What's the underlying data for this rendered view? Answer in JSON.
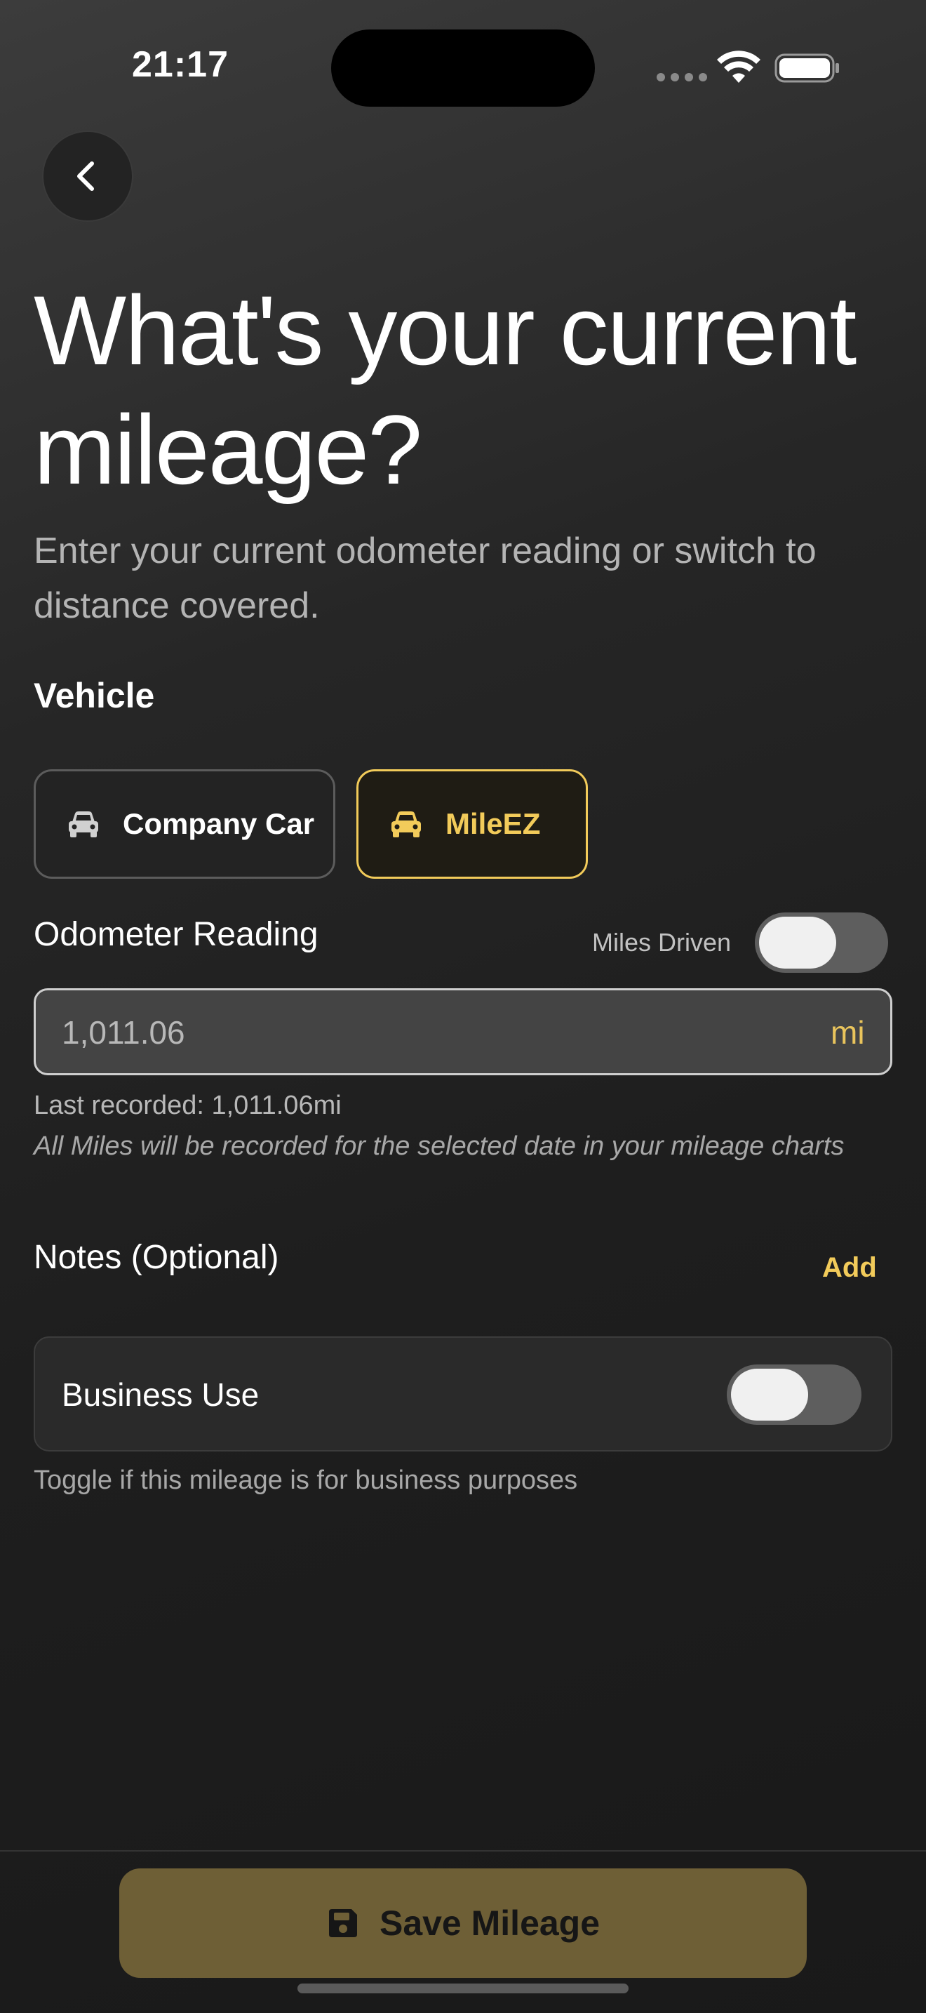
{
  "status_bar": {
    "time": "21:17",
    "icons": [
      "signal-dots-icon",
      "wifi-icon",
      "battery-icon"
    ]
  },
  "nav": {
    "back_icon": "chevron-left-icon"
  },
  "header": {
    "title": "What's your current mileage?",
    "subtitle": "Enter your current odometer reading or switch to distance covered."
  },
  "vehicle": {
    "label": "Vehicle",
    "options": [
      {
        "name": "Company Car",
        "icon": "car-icon",
        "selected": false
      },
      {
        "name": "MileEZ",
        "icon": "car-icon",
        "selected": true
      }
    ]
  },
  "odometer": {
    "label": "Odometer Reading",
    "toggle_label": "Miles Driven",
    "toggle_on": false,
    "value": "1,011.06",
    "unit": "mi",
    "last_recorded": "Last recorded: 1,011.06mi",
    "note": "All Miles will be recorded for the selected date in your mileage charts"
  },
  "notes": {
    "label": "Notes (Optional)",
    "add_label": "Add"
  },
  "business": {
    "label": "Business Use",
    "toggle_on": false,
    "help": "Toggle if this mileage is for business purposes"
  },
  "footer": {
    "save_label": "Save Mileage",
    "save_icon": "floppy-disk-icon"
  },
  "colors": {
    "accent": "#f2cb5a",
    "button_bg": "#6e5f36",
    "background": "#1e1e1e"
  }
}
